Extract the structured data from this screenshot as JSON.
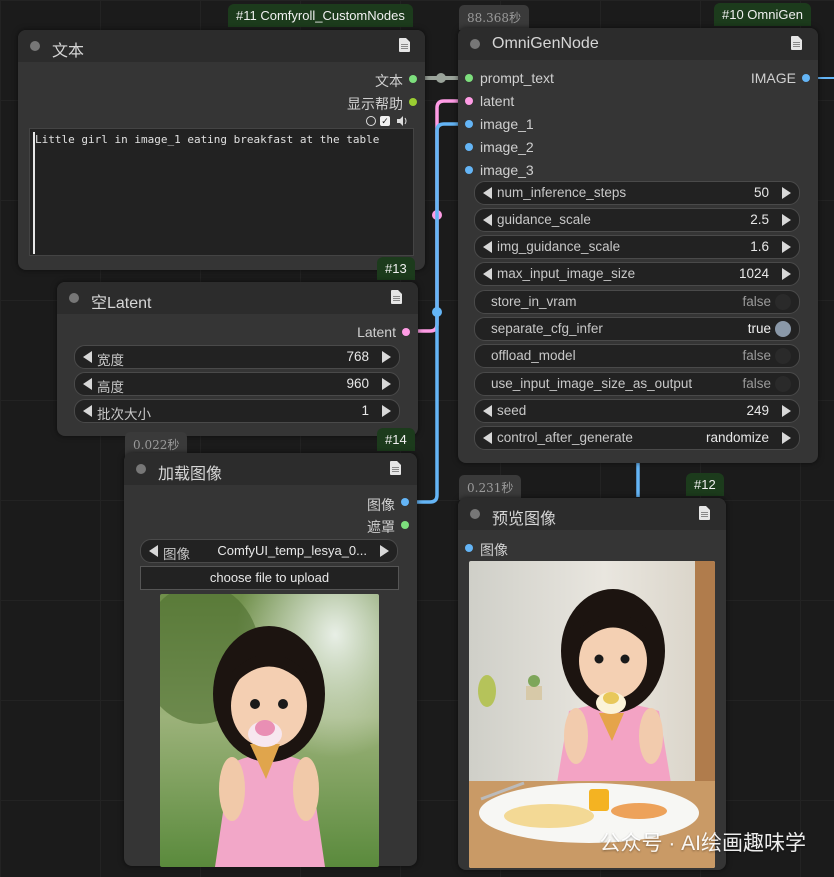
{
  "colors": {
    "string_port": "#7ddf7d",
    "latent_port": "#ff9ce5",
    "image_port": "#64b5f6",
    "boolean_port": "#9acd32",
    "badge_bg": "#1c3b1c"
  },
  "nodes": {
    "text": {
      "badge": "#11 Comfyroll_CustomNodes",
      "title": "文本",
      "outputs": [
        "文本",
        "显示帮助"
      ],
      "prompt": "Little girl in image_1 eating breakfast at the table"
    },
    "latent": {
      "badge": "#13",
      "title": "空Latent",
      "output": "Latent",
      "widgets": [
        {
          "label": "宽度",
          "value": "768"
        },
        {
          "label": "高度",
          "value": "960"
        },
        {
          "label": "批次大小",
          "value": "1"
        }
      ]
    },
    "load_image": {
      "time": "0.022秒",
      "badge": "#14",
      "title": "加载图像",
      "outputs": [
        "图像",
        "遮罩"
      ],
      "image_widget": {
        "label": "图像",
        "value": "ComfyUI_temp_lesya_0..."
      },
      "upload_label": "choose file to upload",
      "image_desc": "girl-with-ice-cream-photo"
    },
    "omnigen": {
      "time": "88.368秒",
      "badge": "#10 OmniGen",
      "title": "OmniGenNode",
      "inputs": [
        "prompt_text",
        "latent",
        "image_1",
        "image_2",
        "image_3"
      ],
      "output": "IMAGE",
      "widgets": [
        {
          "label": "num_inference_steps",
          "value": "50",
          "kind": "number"
        },
        {
          "label": "guidance_scale",
          "value": "2.5",
          "kind": "number"
        },
        {
          "label": "img_guidance_scale",
          "value": "1.6",
          "kind": "number"
        },
        {
          "label": "max_input_image_size",
          "value": "1024",
          "kind": "number"
        },
        {
          "label": "store_in_vram",
          "value": "false",
          "kind": "toggle"
        },
        {
          "label": "separate_cfg_infer",
          "value": "true",
          "kind": "toggle"
        },
        {
          "label": "offload_model",
          "value": "false",
          "kind": "toggle"
        },
        {
          "label": "use_input_image_size_as_output",
          "value": "false",
          "kind": "toggle"
        },
        {
          "label": "seed",
          "value": "249",
          "kind": "number"
        },
        {
          "label": "control_after_generate",
          "value": "randomize",
          "kind": "number"
        }
      ]
    },
    "preview": {
      "time": "0.231秒",
      "badge": "#12",
      "title": "预览图像",
      "input": "图像"
    }
  },
  "watermark": "公众号 · AI绘画趣味学"
}
